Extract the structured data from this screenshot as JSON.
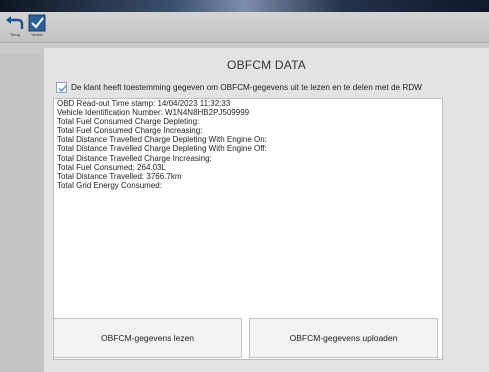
{
  "toolbar": {
    "back_label": "Terug",
    "save_label": "Verder"
  },
  "dialog": {
    "title": "OBFCM DATA",
    "consent": {
      "checked": true,
      "label": "De klant heeft toestemming gegeven om OBFCM-gegevens uit te lezen en te delen met de RDW"
    },
    "lines": [
      "OBD Read-out Time stamp: 14/04/2023 11:32:33",
      "Vehicle Identification Number: W1N4N8HB2PJ509999",
      "Total Fuel Consumed Charge Depleting:",
      "Total Fuel Consumed Charge Increasing:",
      "Total Distance Travelled Charge Depleting With Engine On:",
      "Total Distance Travelled Charge Depleting With Engine Off:",
      "Total Distance Travelled Charge Increasing:",
      "Total Fuel Consumed:   264.03L",
      "Total Distance Travelled:   3766.7km",
      "Total Grid Energy Consumed:"
    ],
    "read_button": "OBFCM-gegevens lezen",
    "upload_button": "OBFCM-gegevens uploaden"
  },
  "colors": {
    "accent": "#2f5f9a",
    "panel": "#e3e3e3",
    "toolbar": "#c9c9c9"
  }
}
